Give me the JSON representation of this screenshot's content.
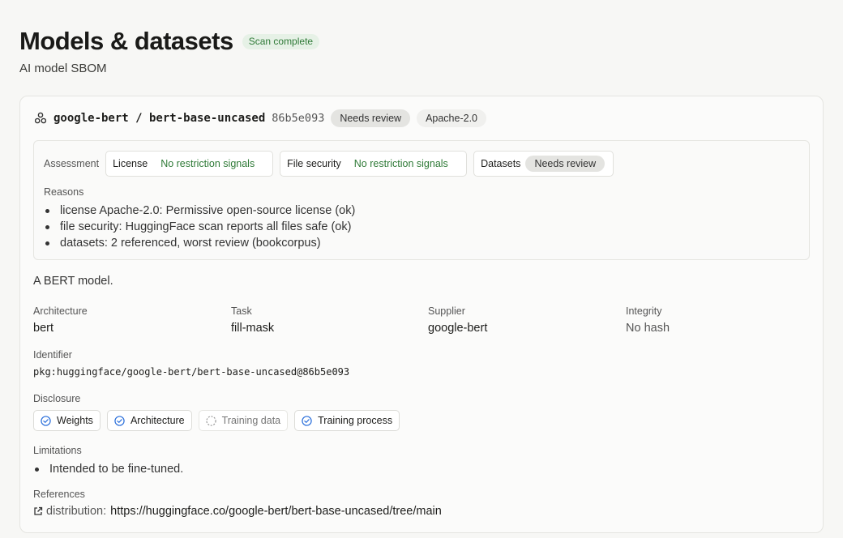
{
  "header": {
    "title": "Models & datasets",
    "badge": "Scan complete",
    "subtitle": "AI model SBOM"
  },
  "model": {
    "name": "google-bert / bert-base-uncased",
    "sha": "86b5e093",
    "review_badge": "Needs review",
    "license_badge": "Apache-2.0",
    "icon": "models-icon"
  },
  "assessment": {
    "label": "Assessment",
    "chips": [
      {
        "key": "License",
        "value": "No restriction signals"
      },
      {
        "key": "File security",
        "value": "No restriction signals"
      },
      {
        "key": "Datasets",
        "value": "Needs review"
      }
    ],
    "reasons_label": "Reasons",
    "reasons": [
      "license Apache-2.0: Permissive open-source license (ok)",
      "file security: HuggingFace scan reports all files safe (ok)",
      "datasets: 2 referenced, worst review (bookcorpus)"
    ]
  },
  "description": "A BERT model.",
  "meta": [
    {
      "key": "Architecture",
      "value": "bert"
    },
    {
      "key": "Task",
      "value": "fill-mask"
    },
    {
      "key": "Supplier",
      "value": "google-bert"
    },
    {
      "key": "Integrity",
      "value": "No hash"
    }
  ],
  "identifier": {
    "label": "Identifier",
    "value": "pkg:huggingface/google-bert/bert-base-uncased@86b5e093"
  },
  "disclosure": {
    "label": "Disclosure",
    "items": [
      {
        "label": "Weights",
        "state": "check-circle-icon"
      },
      {
        "label": "Architecture",
        "state": "check-circle-icon"
      },
      {
        "label": "Training data",
        "state": "dashed-circle-icon"
      },
      {
        "label": "Training process",
        "state": "check-circle-icon"
      }
    ]
  },
  "limitations": {
    "label": "Limitations",
    "items": [
      "Intended to be fine-tuned."
    ]
  },
  "references": {
    "label": "References",
    "items": [
      {
        "key": "distribution:",
        "url": "https://huggingface.co/google-bert/bert-base-uncased/tree/main"
      }
    ]
  },
  "colors": {
    "accent_green": "#2f7a37",
    "badge_green_bg": "#e6f1e6",
    "pill_gray_bg": "#e4e4e1",
    "check_blue": "#2a6fdb"
  }
}
